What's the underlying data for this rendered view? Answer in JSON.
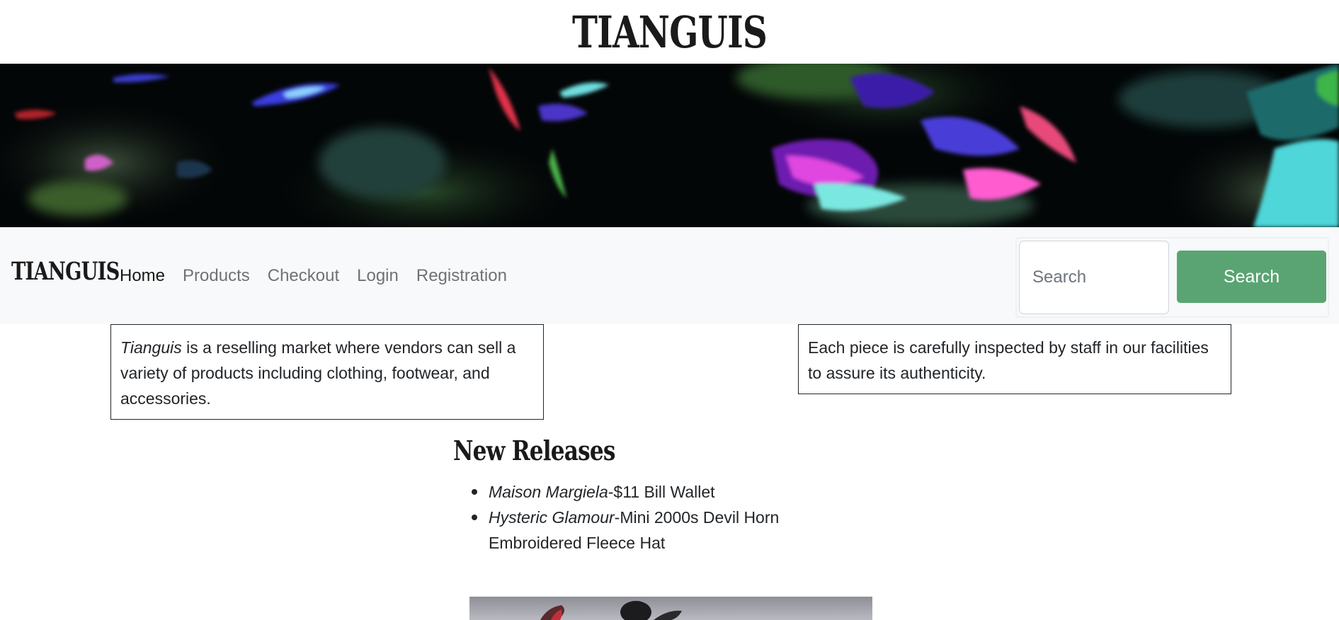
{
  "site": {
    "title": "TIANGUIS"
  },
  "navbar": {
    "brand": "TIANGUIS",
    "links": [
      {
        "label": "Home",
        "active": true
      },
      {
        "label": "Products",
        "active": false
      },
      {
        "label": "Checkout",
        "active": false
      },
      {
        "label": "Login",
        "active": false
      },
      {
        "label": "Registration",
        "active": false
      }
    ],
    "search_placeholder": "Search",
    "search_button": "Search"
  },
  "info": {
    "left_brand": "Tianguis",
    "left_rest": " is a reselling market where vendors can sell a variety of products including clothing, footwear, and accessories.",
    "right": "Each piece is carefully inspected by staff in our facilities to assure its authenticity."
  },
  "new_releases": {
    "heading": "New Releases",
    "items": [
      {
        "brand": "Maison Margiela",
        "name": "-$11 Bill Wallet"
      },
      {
        "brand": "Hysteric Glamour",
        "name": "-Mini 2000s Devil Horn Embroidered Fleece Hat"
      }
    ]
  },
  "colors": {
    "navbar_bg": "#f8f9fa",
    "search_button_bg": "#5aa473",
    "banner_bg": "#030607"
  }
}
